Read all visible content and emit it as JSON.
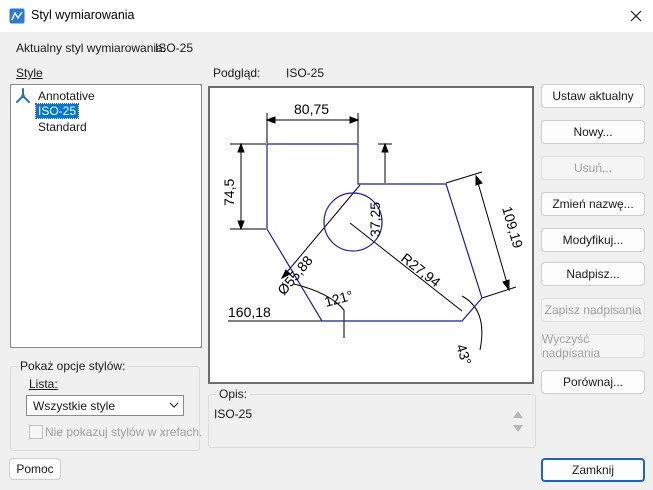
{
  "window": {
    "title": "Styl wymiarowania"
  },
  "current_style": {
    "label": "Aktualny styl wymiarowania:",
    "value": "ISO-25"
  },
  "styles": {
    "label": "Style",
    "items": [
      {
        "label": "Annotative",
        "selected": false,
        "icon": "annotative-icon"
      },
      {
        "label": "ISO-25",
        "selected": true
      },
      {
        "label": "Standard",
        "selected": false
      }
    ]
  },
  "preview": {
    "label": "Podgląd:",
    "style": "ISO-25",
    "dims": {
      "top_width": "80,75",
      "left_height": "74,5",
      "inner_height": "37,25",
      "slant": "109,19",
      "diameter": "Ø55,88",
      "radius": "R27,94",
      "angle": "121°",
      "angle_bottom": "43°",
      "ordinate": "160,18"
    }
  },
  "show_options": {
    "label": "Pokaż opcje stylów:",
    "list_label": "Lista:",
    "list_value": "Wszystkie style",
    "xref_label": "Nie pokazuj stylów w xrefach.",
    "xref_checked": false
  },
  "description": {
    "label": "Opis:",
    "value": "ISO-25"
  },
  "buttons": {
    "set_current": "Ustaw aktualny",
    "new": "Nowy...",
    "delete": "Usuń...",
    "rename": "Zmień nazwę...",
    "modify": "Modyfikuj...",
    "override": "Nadpisz...",
    "save_override": "Zapisz nadpisania",
    "clear_override": "Wyczyść nadpisania",
    "compare": "Porównaj...",
    "help": "Pomoc",
    "close": "Zamknij"
  },
  "colors": {
    "accent": "#0078d7",
    "shape": "#1a1aa8",
    "focus_border": "#1a63c7"
  }
}
